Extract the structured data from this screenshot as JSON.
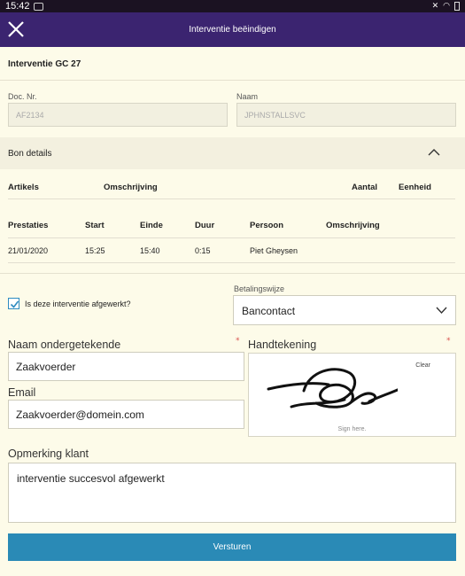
{
  "statusbar": {
    "time": "15:42"
  },
  "appbar": {
    "title": "Interventie beëindigen"
  },
  "intervention": {
    "title": "Interventie GC 27"
  },
  "doc": {
    "label": "Doc. Nr.",
    "value": "AF2134"
  },
  "naam": {
    "label": "Naam",
    "value": "JPHNSTALLSVC"
  },
  "bon": {
    "title": "Bon details",
    "articles_headers": [
      "Artikels",
      "Omschrijving",
      "Aantal",
      "Eenheid"
    ],
    "prestaties_headers": [
      "Prestaties",
      "Start",
      "Einde",
      "Duur",
      "Persoon",
      "Omschrijving"
    ],
    "prestaties_rows": [
      [
        "21/01/2020",
        "15:25",
        "15:40",
        "0:15",
        "Piet Gheysen",
        ""
      ]
    ]
  },
  "afgewerkt": {
    "label": "Is deze interventie afgewerkt?",
    "checked": true
  },
  "betaling": {
    "label": "Betalingswijze",
    "value": "Bancontact"
  },
  "ondergetekende": {
    "label": "Naam ondergetekende",
    "required": "*",
    "value": "Zaakvoerder"
  },
  "handtekening": {
    "label": "Handtekening",
    "required": "*",
    "clear": "Clear",
    "hint": "Sign here."
  },
  "email": {
    "label": "Email",
    "value": "Zaakvoerder@domein.com"
  },
  "opmerking": {
    "label": "Opmerking klant",
    "value": "interventie succesvol afgewerkt"
  },
  "submit": {
    "label": "Versturen"
  },
  "colors": {
    "appbar": "#3b2470",
    "accent": "#2a8ab6",
    "background": "#fdfbe9"
  }
}
